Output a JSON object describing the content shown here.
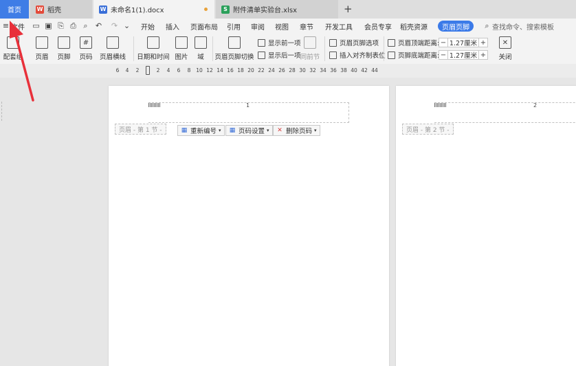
{
  "tabs": {
    "home": "首页",
    "docer": "稻壳",
    "doc": "未命名1(1).docx",
    "xlsx": "附件清单实验台.xlsx"
  },
  "menu": {
    "file": "文件",
    "items": [
      "开始",
      "插入",
      "页面布局",
      "引用",
      "审阅",
      "视图",
      "章节",
      "开发工具",
      "会员专享",
      "稻壳资源"
    ],
    "active": "页眉页脚",
    "search": "查找命令、搜索模板"
  },
  "ribbon": {
    "match": "配套组",
    "header": "页眉",
    "footer": "页脚",
    "page_number": "页码",
    "header_line": "页眉横线",
    "datetime": "日期和时间",
    "picture": "图片",
    "field": "域",
    "switch": "页眉页脚切换",
    "show_prev": "显示前一项",
    "show_next": "显示后一项",
    "same_prev": "同前节",
    "options": "页眉页脚选项",
    "insert_tab": "插入对齐制表位",
    "top_label": "页眉顶端距离:",
    "top_value": "1.27厘米",
    "bottom_label": "页脚底端距离:",
    "bottom_value": "1.27厘米",
    "close": "关闭"
  },
  "ruler": [
    "6",
    "4",
    "2",
    "2",
    "4",
    "6",
    "8",
    "10",
    "12",
    "14",
    "16",
    "18",
    "20",
    "22",
    "24",
    "26",
    "28",
    "30",
    "32",
    "34",
    "36",
    "38",
    "40",
    "42",
    "44"
  ],
  "page1": {
    "header_number": "1",
    "header_tag": "页眉 - 第 1 节 -",
    "renumber": "重新编号",
    "page_setup": "页码设置",
    "delete": "删除页码"
  },
  "page2": {
    "header_number": "2",
    "header_tag": "页眉 - 第 2 节 -"
  },
  "colors": {
    "accent": "#3b7ae8",
    "arrow": "#e8303a"
  }
}
